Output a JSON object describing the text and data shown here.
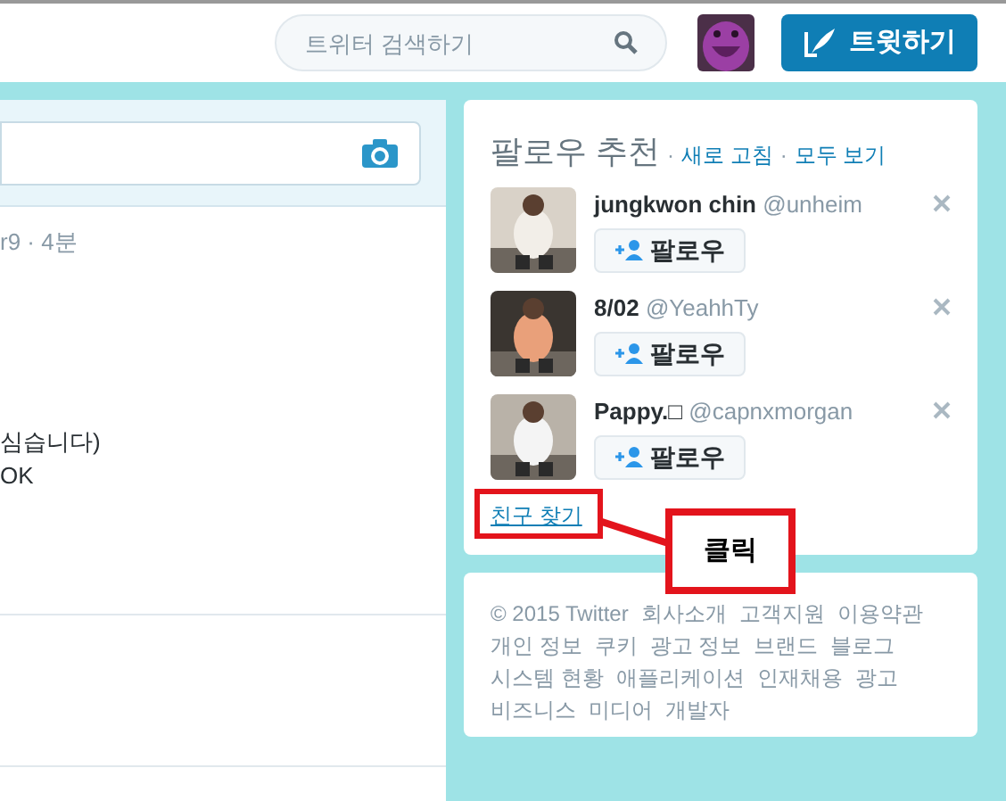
{
  "header": {
    "search": {
      "placeholder": "트위터 검색하기"
    },
    "tweet_button": "트윗하기"
  },
  "timeline": {
    "tweet": {
      "meta": "r9 · 4분",
      "lines": [
        "심습니다)",
        "OK"
      ]
    }
  },
  "who_to_follow": {
    "title": "팔로우 추천",
    "separator": "·",
    "refresh": "새로 고침",
    "view_all": "모두 보기",
    "users": [
      {
        "name": "jungkwon chin",
        "handle": "@unheim",
        "follow": "팔로우"
      },
      {
        "name": "8/02",
        "handle": "@YeahhTy",
        "follow": "팔로우"
      },
      {
        "name": "Pappy.□",
        "handle": "@capnxmorgan",
        "follow": "팔로우"
      }
    ],
    "find_friends": "친구 찾기"
  },
  "footer_links": [
    "© 2015 Twitter",
    "회사소개",
    "고객지원",
    "이용약관",
    "개인 정보",
    "쿠키",
    "광고 정보",
    "브랜드",
    "블로그",
    "시스템 현황",
    "애플리케이션",
    "인재채용",
    "광고",
    "비즈니스",
    "미디어",
    "개발자"
  ],
  "annotation": {
    "label": "클릭"
  }
}
